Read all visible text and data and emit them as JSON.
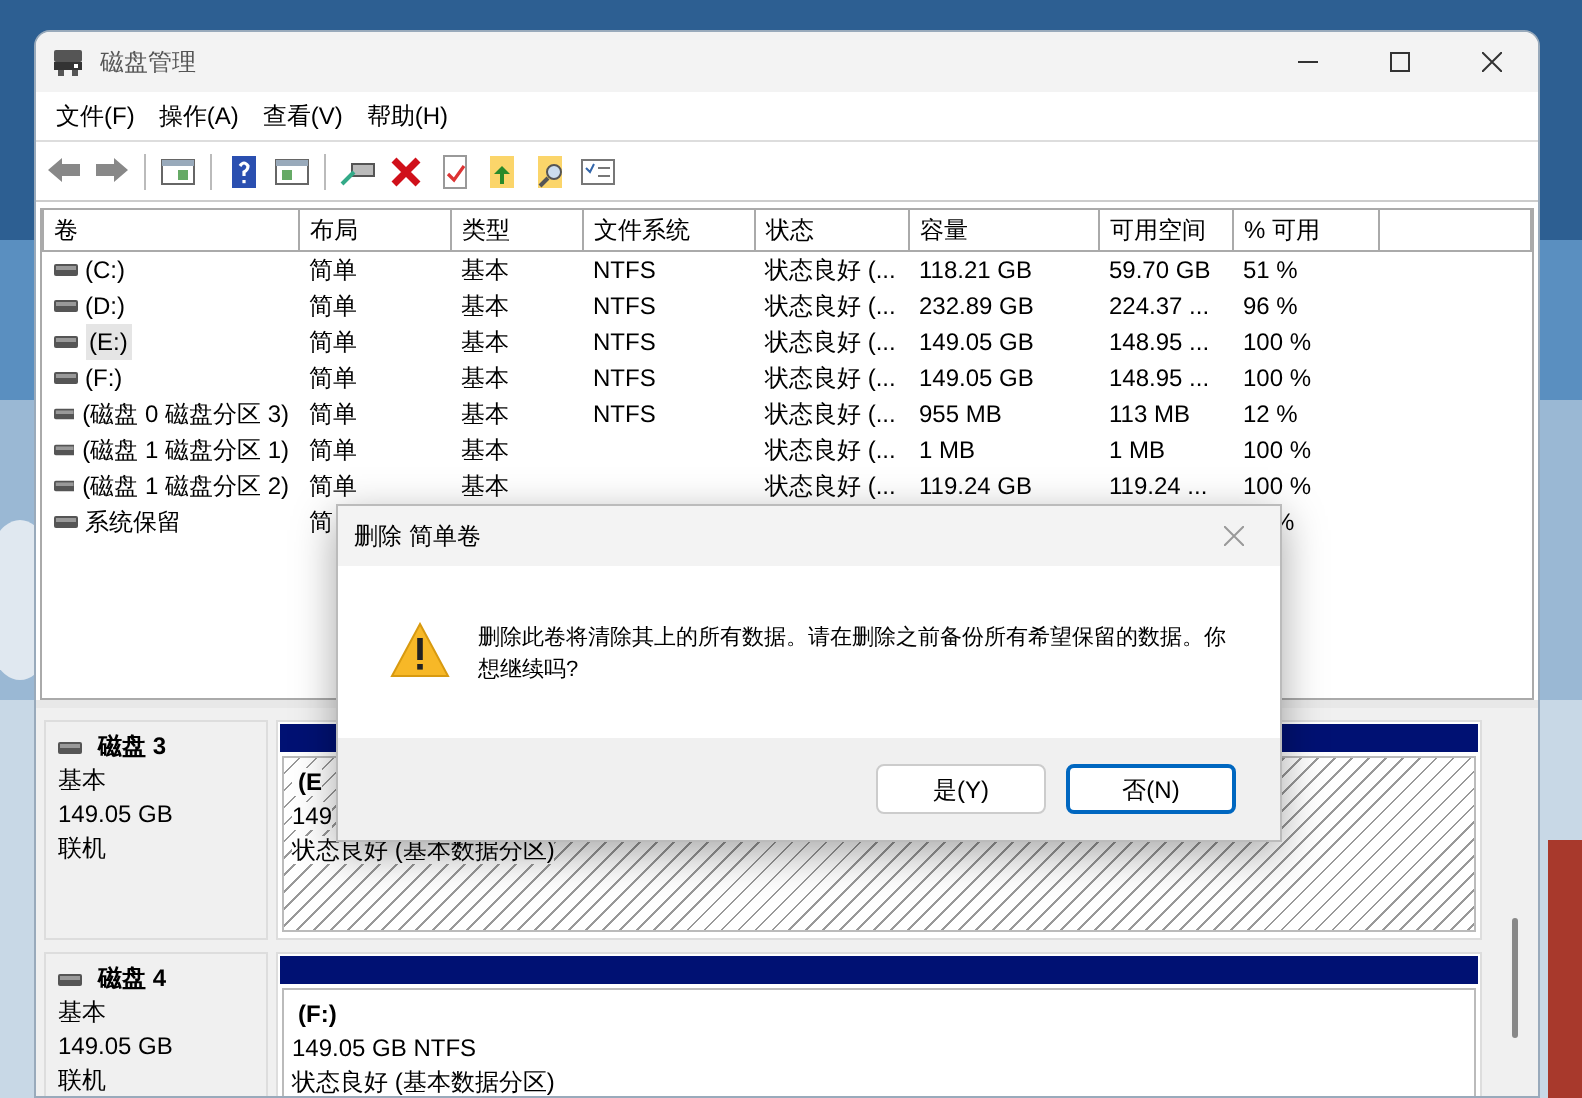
{
  "window": {
    "title": "磁盘管理"
  },
  "menu": [
    "文件(F)",
    "操作(A)",
    "查看(V)",
    "帮助(H)"
  ],
  "toolbar": [
    {
      "kind": "back"
    },
    {
      "kind": "forward"
    },
    {
      "kind": "sep"
    },
    {
      "kind": "pane"
    },
    {
      "kind": "sep"
    },
    {
      "kind": "help"
    },
    {
      "kind": "pane2"
    },
    {
      "kind": "sep"
    },
    {
      "kind": "connect"
    },
    {
      "kind": "delete"
    },
    {
      "kind": "check"
    },
    {
      "kind": "folderup"
    },
    {
      "kind": "foldersearch"
    },
    {
      "kind": "list"
    }
  ],
  "table": {
    "columns": [
      "卷",
      "布局",
      "类型",
      "文件系统",
      "状态",
      "容量",
      "可用空间",
      "% 可用"
    ],
    "rows": [
      {
        "volume": "(C:)",
        "layout": "简单",
        "type": "基本",
        "fs": "NTFS",
        "status": "状态良好 (...",
        "capacity": "118.21 GB",
        "free": "59.70 GB",
        "pct": "51 %",
        "selected": false
      },
      {
        "volume": "(D:)",
        "layout": "简单",
        "type": "基本",
        "fs": "NTFS",
        "status": "状态良好 (...",
        "capacity": "232.89 GB",
        "free": "224.37 ...",
        "pct": "96 %",
        "selected": false
      },
      {
        "volume": "(E:)",
        "layout": "简单",
        "type": "基本",
        "fs": "NTFS",
        "status": "状态良好 (...",
        "capacity": "149.05 GB",
        "free": "148.95 ...",
        "pct": "100 %",
        "selected": true
      },
      {
        "volume": "(F:)",
        "layout": "简单",
        "type": "基本",
        "fs": "NTFS",
        "status": "状态良好 (...",
        "capacity": "149.05 GB",
        "free": "148.95 ...",
        "pct": "100 %",
        "selected": false
      },
      {
        "volume": "(磁盘 0 磁盘分区 3)",
        "layout": "简单",
        "type": "基本",
        "fs": "NTFS",
        "status": "状态良好 (...",
        "capacity": "955 MB",
        "free": "113 MB",
        "pct": "12 %",
        "selected": false
      },
      {
        "volume": "(磁盘 1 磁盘分区 1)",
        "layout": "简单",
        "type": "基本",
        "status": "状态良好 (...",
        "capacity": "1 MB",
        "free": "1 MB",
        "pct": "100 %",
        "selected": false
      },
      {
        "volume": "(磁盘 1 磁盘分区 2)",
        "layout": "简单",
        "type": "基本",
        "status": "状态良好 (...",
        "capacity": "119.24 GB",
        "free": "119.24 ...",
        "pct": "100 %",
        "selected": false
      },
      {
        "volume": "系统保留",
        "layout": "简",
        "pct": "%",
        "selected": false
      }
    ]
  },
  "disks": [
    {
      "name": "磁盘 3",
      "type": "基本",
      "size": "149.05 GB",
      "state": "联机",
      "partitions": [
        {
          "label": "(E",
          "size_fs": "149",
          "status": "状态良好 (基本数据分区)",
          "selected": true
        }
      ]
    },
    {
      "name": "磁盘 4",
      "type": "基本",
      "size": "149.05 GB",
      "state": "联机",
      "partitions": [
        {
          "label": "(F:)",
          "size_fs": "149.05 GB NTFS",
          "status": "状态良好 (基本数据分区)",
          "selected": false
        }
      ]
    }
  ],
  "dialog": {
    "title": "删除 简单卷",
    "message": "删除此卷将清除其上的所有数据。请在删除之前备份所有希望保留的数据。你想继续吗?",
    "buttons": [
      {
        "label": "是(Y)",
        "selected": false
      },
      {
        "label": "否(N)",
        "selected": true
      }
    ]
  }
}
